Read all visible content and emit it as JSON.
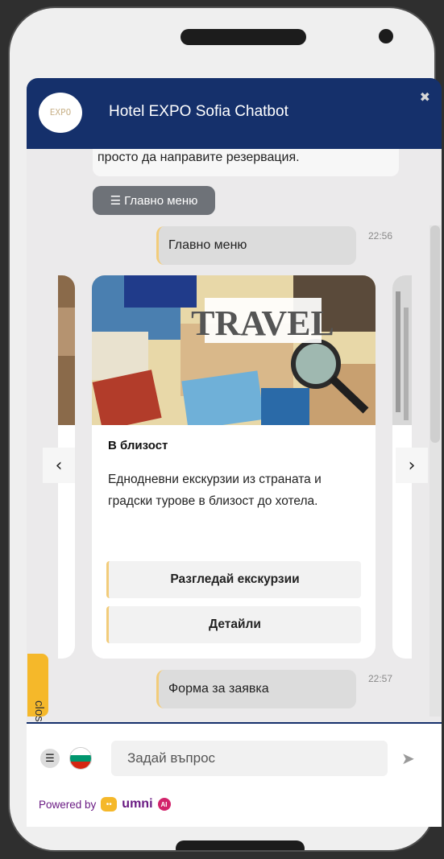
{
  "header": {
    "title": "Hotel EXPO Sofia Chatbot",
    "logo_text": "EXPO",
    "close_icon": "close-icon"
  },
  "messages": {
    "previous_bot_text": "просто да направите резервация.",
    "main_menu_chip": "Главно меню",
    "user_msg_1": {
      "text": "Главно меню",
      "time": "22:56"
    },
    "user_msg_2": {
      "text": "Форма за заявка",
      "time": "22:57"
    }
  },
  "carousel": {
    "card": {
      "title": "В близост",
      "description": "Еднодневни екскурзии из страната и градски турове в близост до хотела.",
      "image_text": "TRAVEL",
      "buttons": [
        "Разгледай екскурзии",
        "Детайли"
      ]
    },
    "prev_arrow": "‹",
    "next_arrow": "›"
  },
  "close_tab": "close",
  "footer": {
    "input_placeholder": "Задай въпрос",
    "powered_by": "Powered by",
    "brand": "umni",
    "ai_badge": "AI"
  },
  "colors": {
    "header": "#15306b",
    "accent": "#f2cc7a",
    "close_tab": "#f5b82a",
    "brand": "#6a1b83"
  }
}
